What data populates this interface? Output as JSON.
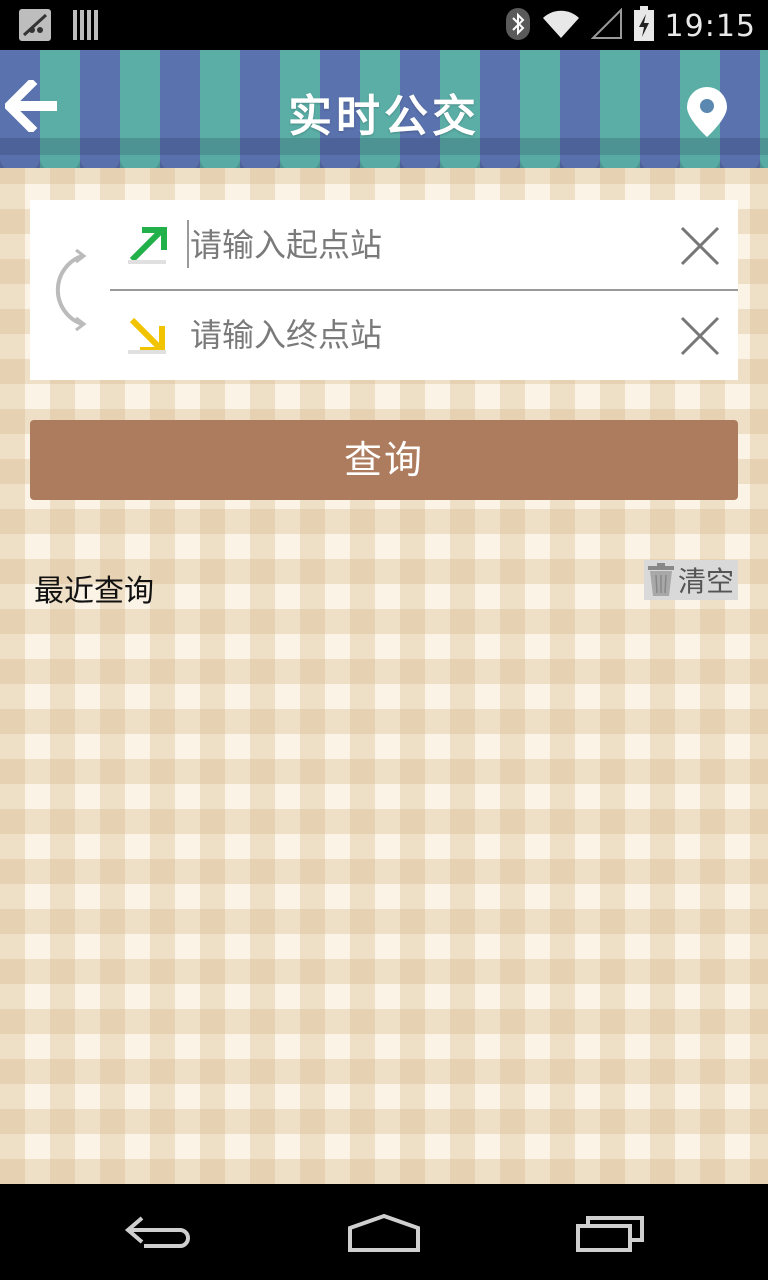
{
  "status_bar": {
    "time": "19:15",
    "icons": [
      "notification-app-icon",
      "notification-bars-icon",
      "bluetooth-icon",
      "wifi-icon",
      "signal-icon",
      "battery-charging-icon"
    ]
  },
  "header": {
    "title": "实时公交",
    "back_icon": "back-arrow-icon",
    "location_icon": "location-pin-icon",
    "colors": {
      "stripe_blue": "#5a72ad",
      "stripe_teal": "#5aaea6"
    }
  },
  "route_inputs": {
    "start": {
      "placeholder": "请输入起点站",
      "value": "",
      "arrow_color": "#22b04a"
    },
    "end": {
      "placeholder": "请输入终点站",
      "value": "",
      "arrow_color": "#f2c400"
    }
  },
  "query_button": {
    "label": "查询",
    "color": "#ad7c5e"
  },
  "recent": {
    "label": "最近查询",
    "clear_label": "清空",
    "items": []
  },
  "nav_bar": {
    "icons": [
      "back-icon",
      "home-icon",
      "recents-icon"
    ]
  }
}
